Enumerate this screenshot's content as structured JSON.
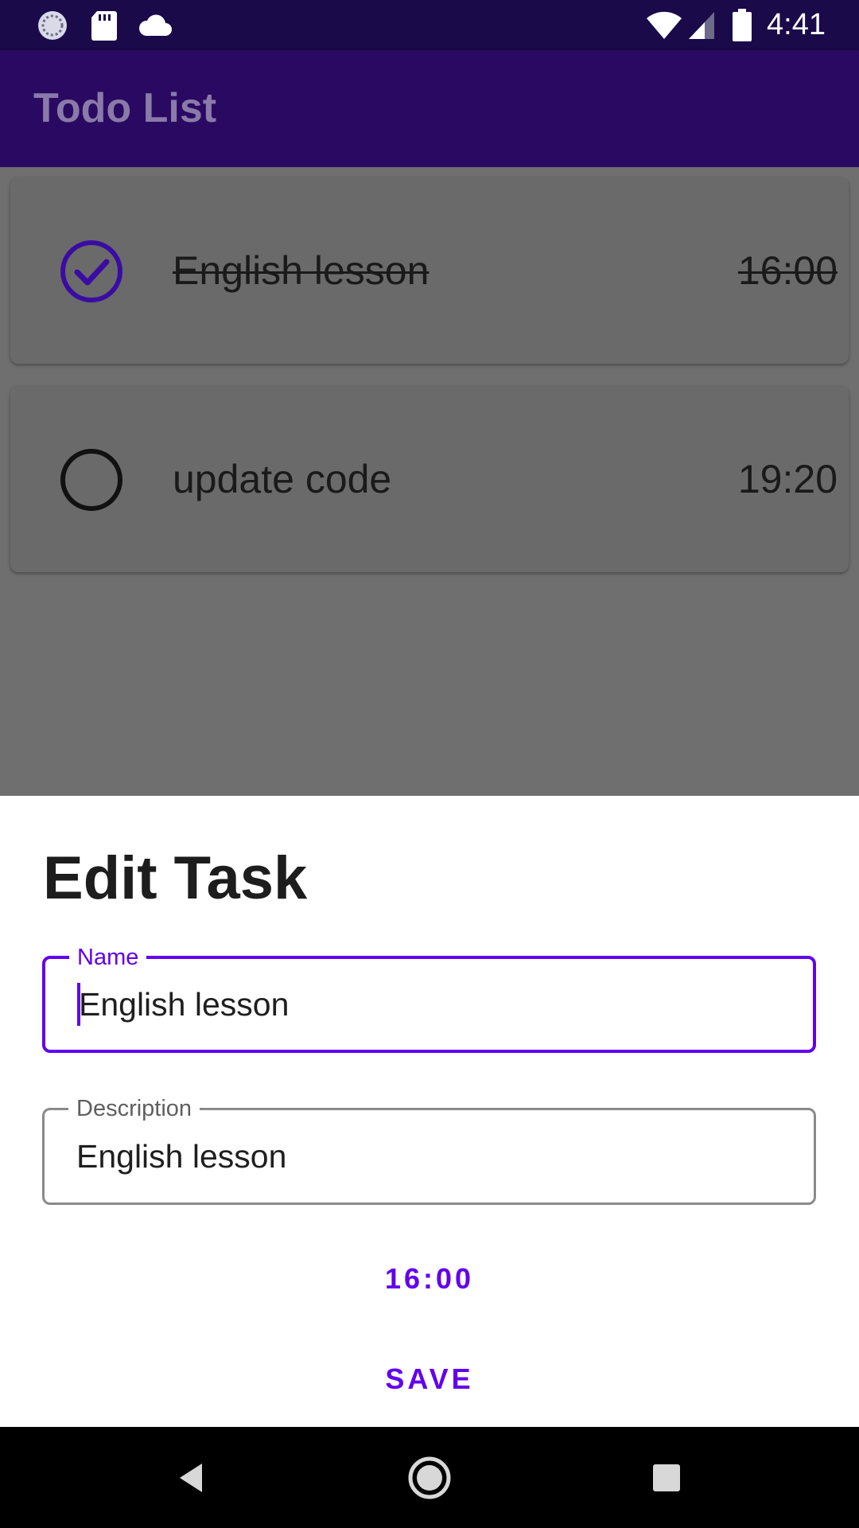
{
  "status_bar": {
    "time": "4:41",
    "left_icons": [
      "sync-icon",
      "sd-card-icon",
      "cloud-icon"
    ],
    "right_icons": [
      "wifi-icon",
      "signal-icon",
      "battery-icon"
    ]
  },
  "app_bar": {
    "title": "Todo List"
  },
  "tasks": [
    {
      "name": "English lesson",
      "time": "16:00",
      "done": true
    },
    {
      "name": "update code",
      "time": "19:20",
      "done": false
    }
  ],
  "dialog": {
    "title": "Edit Task",
    "name_field": {
      "label": "Name",
      "value": "English lesson"
    },
    "description_field": {
      "label": "Description",
      "value": "English lesson"
    },
    "time_button": "16:00",
    "save_button": "SAVE"
  },
  "colors": {
    "accent": "#6200ee",
    "app_bar": "#2a0963",
    "status_bar": "#1a0a4a"
  }
}
